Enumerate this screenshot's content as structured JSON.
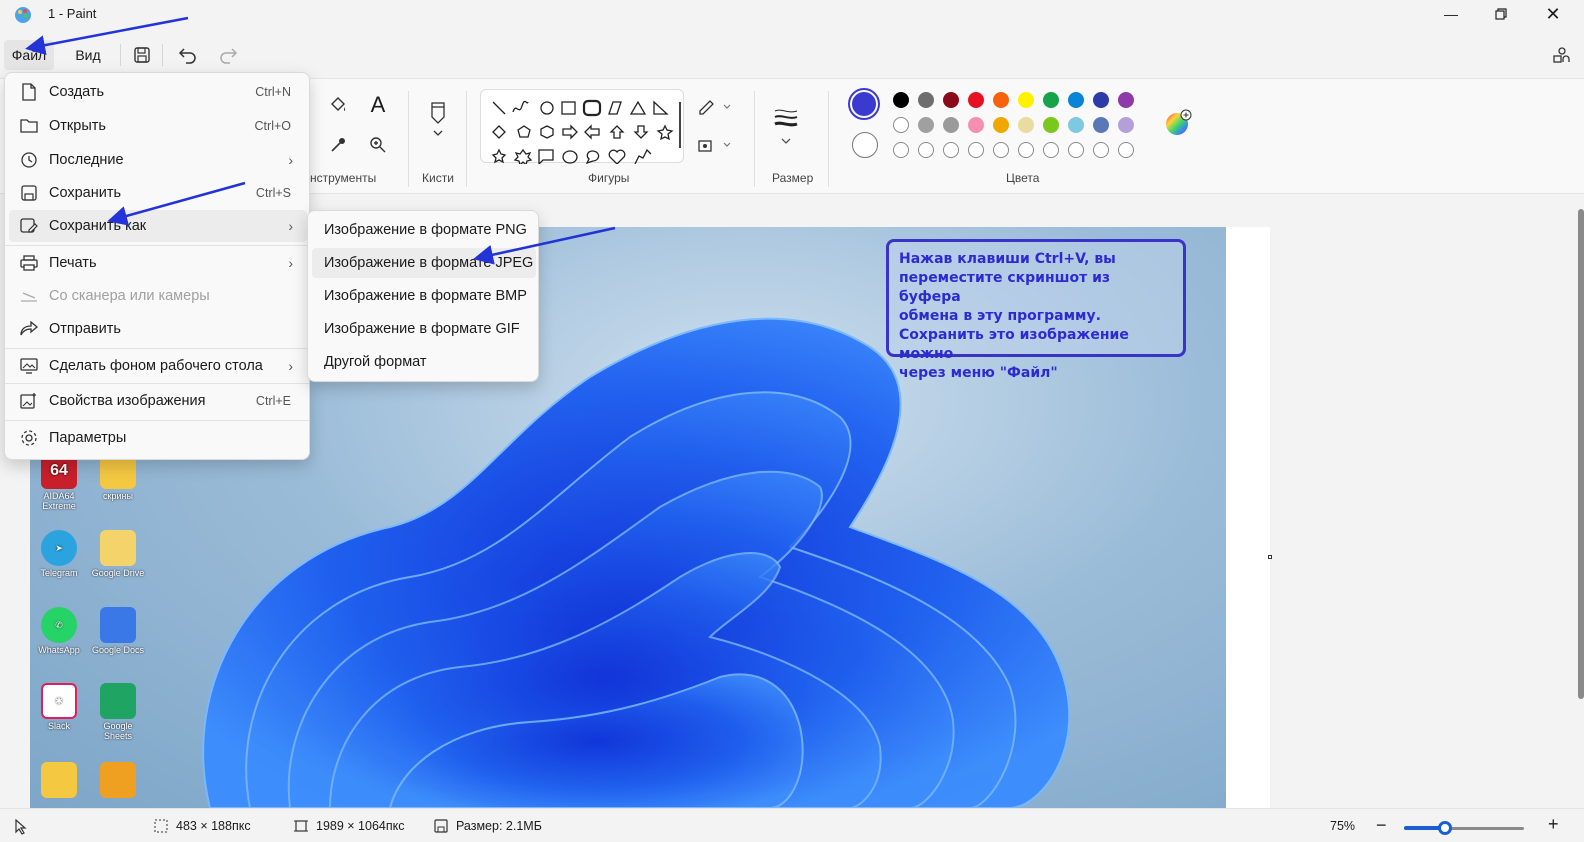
{
  "window": {
    "title": "1 - Paint"
  },
  "menubar": {
    "file": "Файл",
    "view": "Вид"
  },
  "ribbon": {
    "tools_label": "нструменты",
    "brushes_label": "Кисти",
    "shapes_label": "Фигуры",
    "size_label": "Размер",
    "colors_label": "Цвета"
  },
  "colors": {
    "primary": "#3a3ad0",
    "row1": [
      "#000000",
      "#6e6e6e",
      "#8b0a1a",
      "#e81123",
      "#f7630c",
      "#fff100",
      "#16a34a",
      "#0a84d8",
      "#2e3aa8",
      "#8e3aa8"
    ],
    "row2": [
      "#ffffff",
      "#a0a0a0",
      "#9a9a9a",
      "#f48fb1",
      "#f0a800",
      "#e8dca0",
      "#7ac81b",
      "#7ec8e0",
      "#5a78b8",
      "#b4a0d8"
    ]
  },
  "file_menu": {
    "items": [
      {
        "label": "Создать",
        "shortcut": "Ctrl+N",
        "icon": "new-file-icon"
      },
      {
        "label": "Открыть",
        "shortcut": "Ctrl+O",
        "icon": "folder-icon"
      },
      {
        "label": "Последние",
        "shortcut": "",
        "icon": "clock-icon"
      },
      {
        "label": "Сохранить",
        "shortcut": "Ctrl+S",
        "icon": "save-icon"
      },
      {
        "label": "Сохранить как",
        "shortcut": "",
        "icon": "save-as-icon"
      },
      {
        "label": "Печать",
        "shortcut": "",
        "icon": "printer-icon"
      },
      {
        "label": "Со сканера или камеры",
        "shortcut": "",
        "icon": "scanner-icon"
      },
      {
        "label": "Отправить",
        "shortcut": "",
        "icon": "send-icon"
      },
      {
        "label": "Сделать фоном рабочего стола",
        "shortcut": "",
        "icon": "wallpaper-icon"
      },
      {
        "label": "Свойства изображения",
        "shortcut": "Ctrl+E",
        "icon": "image-properties-icon"
      },
      {
        "label": "Параметры",
        "shortcut": "",
        "icon": "gear-icon"
      }
    ]
  },
  "save_as_menu": {
    "items": [
      "Изображение в формате PNG",
      "Изображение в формате JPEG",
      "Изображение в формате BMP",
      "Изображение в формате GIF",
      "Другой формат"
    ]
  },
  "note": {
    "lines": [
      "Нажав клавиши Ctrl+V, вы",
      "переместите скриншот из буфера",
      "обмена в эту программу.",
      "Сохранить это изображение можно",
      "через меню \"Файл\""
    ]
  },
  "desktop_icons": [
    {
      "label": "AIDA64 Extreme",
      "icon": "aida64-icon"
    },
    {
      "label": "скрины",
      "icon": "folder-icon"
    },
    {
      "label": "Telegram",
      "icon": "telegram-icon"
    },
    {
      "label": "Google Drive",
      "icon": "google-drive-icon"
    },
    {
      "label": "WhatsApp",
      "icon": "whatsapp-icon"
    },
    {
      "label": "Google Docs",
      "icon": "google-docs-icon"
    },
    {
      "label": "Slack",
      "icon": "slack-icon"
    },
    {
      "label": "Google Sheets",
      "icon": "google-sheets-icon"
    }
  ],
  "aida_badge": "64",
  "statusbar": {
    "selection": "483 × 188пкс",
    "canvas_size": "1989 × 1064пкс",
    "file_size": "Размер: 2.1МБ",
    "zoom": "75%"
  }
}
